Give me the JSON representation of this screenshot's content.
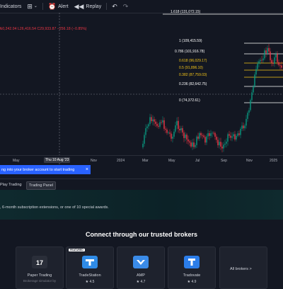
{
  "toolbar": {
    "indicators_label": "Indicators",
    "alert_label": "Alert",
    "replay_label": "Replay",
    "icons": [
      "templates-icon",
      "alert-icon",
      "replay-icon",
      "undo-icon",
      "redo-icon"
    ]
  },
  "chart": {
    "ohlc_text": "₺0,242.04 L26,416.54 C29,933.87 −256.18 (−0.85%)",
    "fib_levels": [
      {
        "label": "1.618 (131,072.15)",
        "color": "#ffffff"
      },
      {
        "label": "1 (109,415.59)",
        "color": "#ffffff"
      },
      {
        "label": "0.786 (101,916.78)",
        "color": "#ffffff"
      },
      {
        "label": "0.618 (96,029.17)",
        "color": "#f5c518"
      },
      {
        "label": "0.5 (91,896.10)",
        "color": "#f5c518"
      },
      {
        "label": "0.382 (87,759.03)",
        "color": "#f5c518"
      },
      {
        "label": "0.236 (82,642.75)",
        "color": "#ffffff"
      },
      {
        "label": "0 (74,372.61)",
        "color": "#ffffff"
      }
    ],
    "colors": {
      "up": "#089981",
      "down": "#f23645",
      "background": "#131722"
    }
  },
  "time_axis": {
    "ticks": [
      "May",
      "Thu 10 Aug '23",
      "Nov",
      "2024",
      "Mar",
      "May",
      "Jul",
      "Sep",
      "Nov",
      "2025"
    ]
  },
  "notice": {
    "text": "ng into your broker account to start trading"
  },
  "tabs": [
    {
      "label": "Play Trading"
    },
    {
      "label": "Trading Panel"
    }
  ],
  "promo": {
    "text": ", 6-month subscription extensions, or one of 10 special awards."
  },
  "brokers": {
    "title": "Connect through our trusted brokers",
    "cards": [
      {
        "name": "Paper Trading",
        "sub": "Brokerage simulator by",
        "featured": false,
        "logo_color": "#2a2e39"
      },
      {
        "name": "TradeStation",
        "rating": "★ 4.5",
        "featured": true,
        "featured_label": "FEATURED",
        "logo_color": "#2f8be6"
      },
      {
        "name": "AMP",
        "rating": "★ 4.7",
        "featured": false,
        "logo_color": "#3a8be8"
      },
      {
        "name": "Tradovate",
        "rating": "★ 4.9",
        "featured": false,
        "logo_color": "#2b7de9"
      }
    ],
    "all_brokers_label": "All brokers >"
  }
}
